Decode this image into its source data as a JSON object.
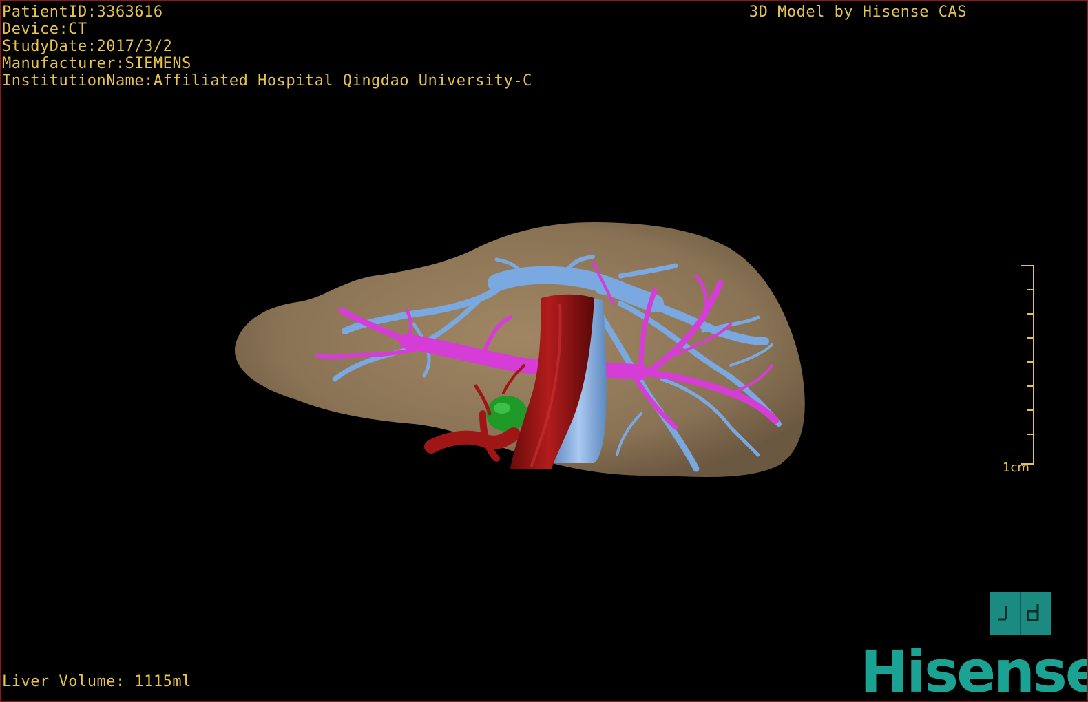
{
  "overlay": {
    "patient_id": "PatientID:3363616",
    "device": "Device:CT",
    "study_date": "StudyDate:2017/3/2",
    "manufacturer": "Manufacturer:SIEMENS",
    "institution": "InstitutionName:Affiliated Hospital Qingdao University-C",
    "credit": "3D Model by Hisense CAS",
    "liver_volume": "Liver Volume: 1115ml"
  },
  "scale": {
    "label": "1cm"
  },
  "logo": {
    "text": "Hisense"
  },
  "colors": {
    "text": "#e6c34a",
    "liver": "#8a7355",
    "hepatic_vein": "#7aa8e0",
    "portal_vein": "#d63cd6",
    "artery": "#9e1616",
    "gallbladder": "#1f9a28",
    "brand": "#1aa393"
  },
  "icons": {
    "view_toggle": "view-toggle-icon"
  }
}
